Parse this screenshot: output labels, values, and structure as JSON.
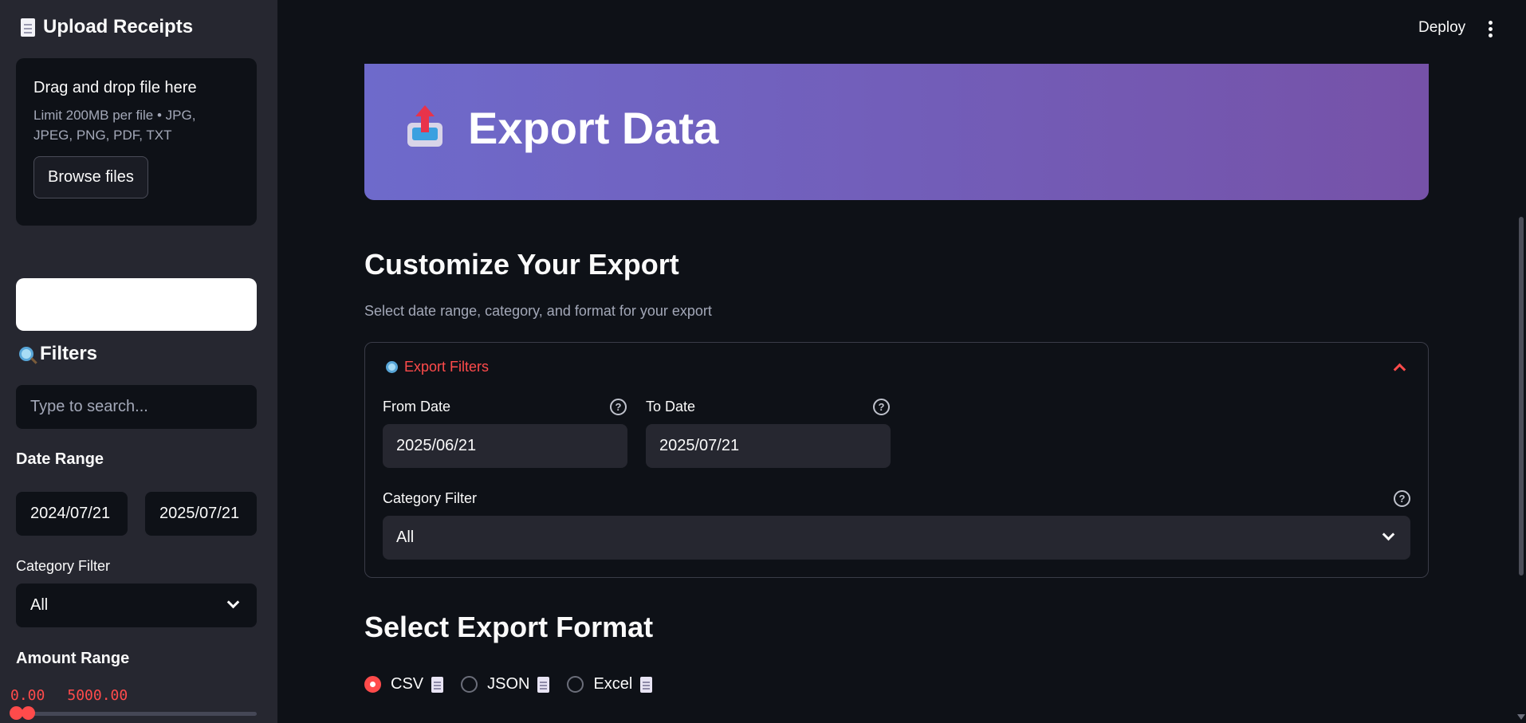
{
  "sidebar": {
    "upload_title": "Upload Receipts",
    "uploader": {
      "title": "Drag and drop file here",
      "limit": "Limit 200MB per file • JPG, JPEG, PNG, PDF, TXT",
      "browse_label": "Browse files"
    },
    "filters_title": "Filters",
    "search_placeholder": "Type to search...",
    "date_range_label": "Date Range",
    "date_start": "2024/07/21",
    "date_end": "2025/07/21",
    "category_label": "Category Filter",
    "category_value": "All",
    "amount_label": "Amount Range",
    "amount_min": "0.00",
    "amount_max": "5000.00"
  },
  "header": {
    "deploy_label": "Deploy"
  },
  "main": {
    "hero_title": "Export Data",
    "customize_title": "Customize Your Export",
    "customize_subtitle": "Select date range, category, and format for your export",
    "expander": {
      "title": "Export Filters",
      "from_label": "From Date",
      "from_value": "2025/06/21",
      "to_label": "To Date",
      "to_value": "2025/07/21",
      "category_label": "Category Filter",
      "category_value": "All",
      "help_glyph": "?"
    },
    "format_title": "Select Export Format",
    "formats": [
      {
        "label": "CSV",
        "selected": true
      },
      {
        "label": "JSON",
        "selected": false
      },
      {
        "label": "Excel",
        "selected": false
      }
    ]
  },
  "colors": {
    "accent": "#ff4b4b",
    "sidebar_bg": "#262730",
    "main_bg": "#0e1117",
    "hero_gradient_start": "#6e6acb",
    "hero_gradient_end": "#7652a8"
  }
}
